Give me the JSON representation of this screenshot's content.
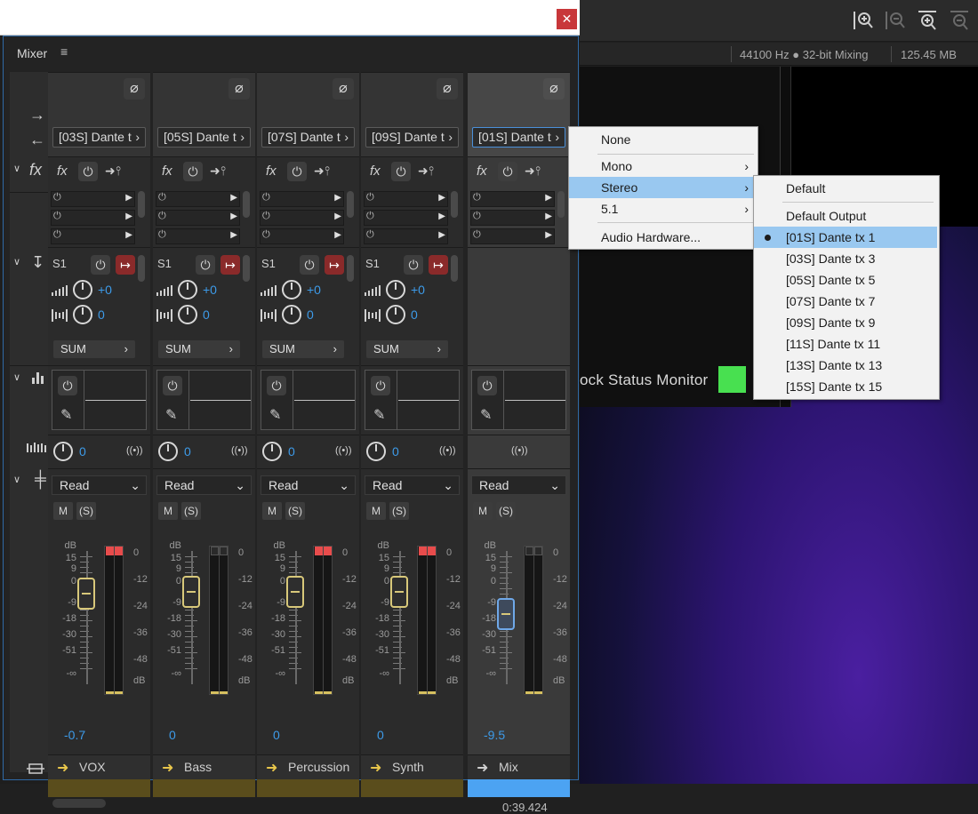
{
  "background_app": {
    "sample_rate": "44100 Hz ● 32-bit Mixing",
    "memory": "125.45 MB",
    "lock_status_label": "ock Status Monitor",
    "colors": {
      "lock_indicator": "#48e050"
    }
  },
  "window": {
    "close_glyph": "✕"
  },
  "mixer": {
    "title": "Mixer",
    "menu_glyph": "≡",
    "timecode": "0:39.424",
    "channels": [
      {
        "output": "[03S] Dante t",
        "send": "S1",
        "send_vol": "+0",
        "send_pan": "0",
        "bus": "SUM",
        "pan": "0",
        "automation": "Read",
        "fader": "-0.7",
        "name": "VOX",
        "fader_db": -0.7
      },
      {
        "output": "[05S] Dante t",
        "send": "S1",
        "send_vol": "+0",
        "send_pan": "0",
        "bus": "SUM",
        "pan": "0",
        "automation": "Read",
        "fader": "0",
        "name": "Bass",
        "fader_db": 0
      },
      {
        "output": "[07S] Dante t",
        "send": "S1",
        "send_vol": "+0",
        "send_pan": "0",
        "bus": "SUM",
        "pan": "0",
        "automation": "Read",
        "fader": "0",
        "name": "Percussion",
        "fader_db": 0
      },
      {
        "output": "[09S] Dante t",
        "send": "S1",
        "send_vol": "+0",
        "send_pan": "0",
        "bus": "SUM",
        "pan": "0",
        "automation": "Read",
        "fader": "0",
        "name": "Synth",
        "fader_db": 0
      },
      {
        "output": "[01S] Dante t",
        "automation": "Read",
        "fader": "-9.5",
        "name": "Mix",
        "fader_db": -9.5
      }
    ],
    "ms_labels": {
      "mute": "M",
      "solo": "(S)"
    },
    "db_scale_left": [
      "dB",
      "15",
      "9",
      "0",
      "-9",
      "-18",
      "-30",
      "-51",
      "-∞"
    ],
    "db_scale_right": [
      "0",
      "-12",
      "-24",
      "-36",
      "-48",
      "dB"
    ]
  },
  "output_menu": {
    "items": [
      "None",
      "Mono",
      "Stereo",
      "5.1",
      "Audio Hardware..."
    ],
    "highlighted": "Stereo"
  },
  "stereo_submenu": {
    "items": [
      "Default",
      "Default Output",
      "[01S] Dante tx 1",
      "[03S] Dante tx 3",
      "[05S] Dante tx 5",
      "[07S] Dante tx 7",
      "[09S] Dante tx 9",
      "[11S] Dante tx 11",
      "[13S] Dante tx 13",
      "[15S] Dante tx 15"
    ],
    "selected": "[01S] Dante tx 1"
  }
}
